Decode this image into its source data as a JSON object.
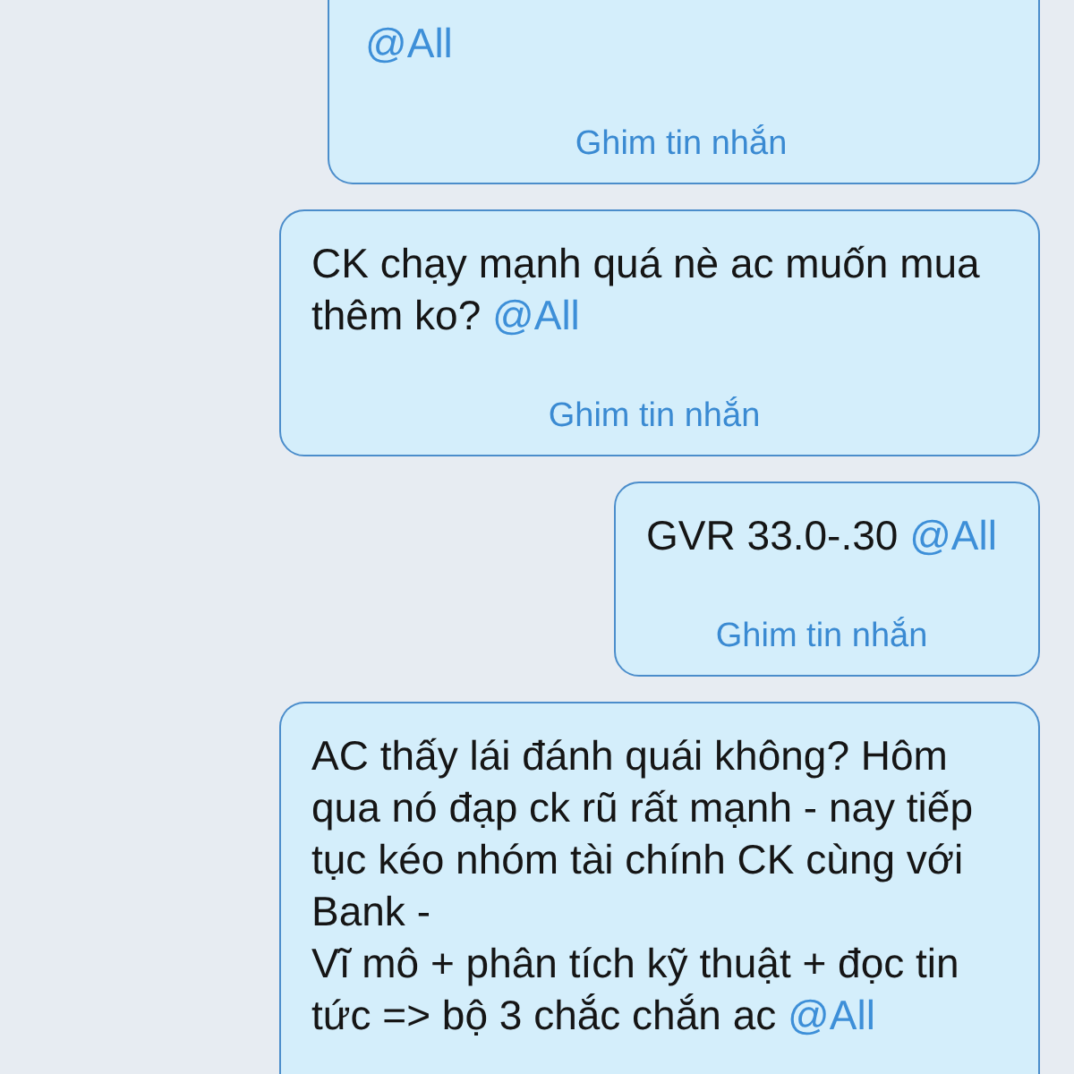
{
  "messages": [
    {
      "mention": "@All",
      "pin_label": "Ghim tin nhắn"
    },
    {
      "text": "CK chạy mạnh quá nè ac muốn mua thêm ko?",
      "mention": "@All",
      "pin_label": "Ghim tin nhắn"
    },
    {
      "text": "GVR 33.0-.30",
      "mention": "@All",
      "pin_label": "Ghim tin nhắn"
    },
    {
      "text": "AC thấy lái đánh quái không? Hôm qua nó đạp ck rũ rất mạnh - nay tiếp tục kéo nhóm tài chính CK cùng với Bank -\nVĩ mô + phân tích kỹ thuật + đọc tin tức => bộ 3 chắc chắn ac",
      "mention": "@All"
    }
  ]
}
